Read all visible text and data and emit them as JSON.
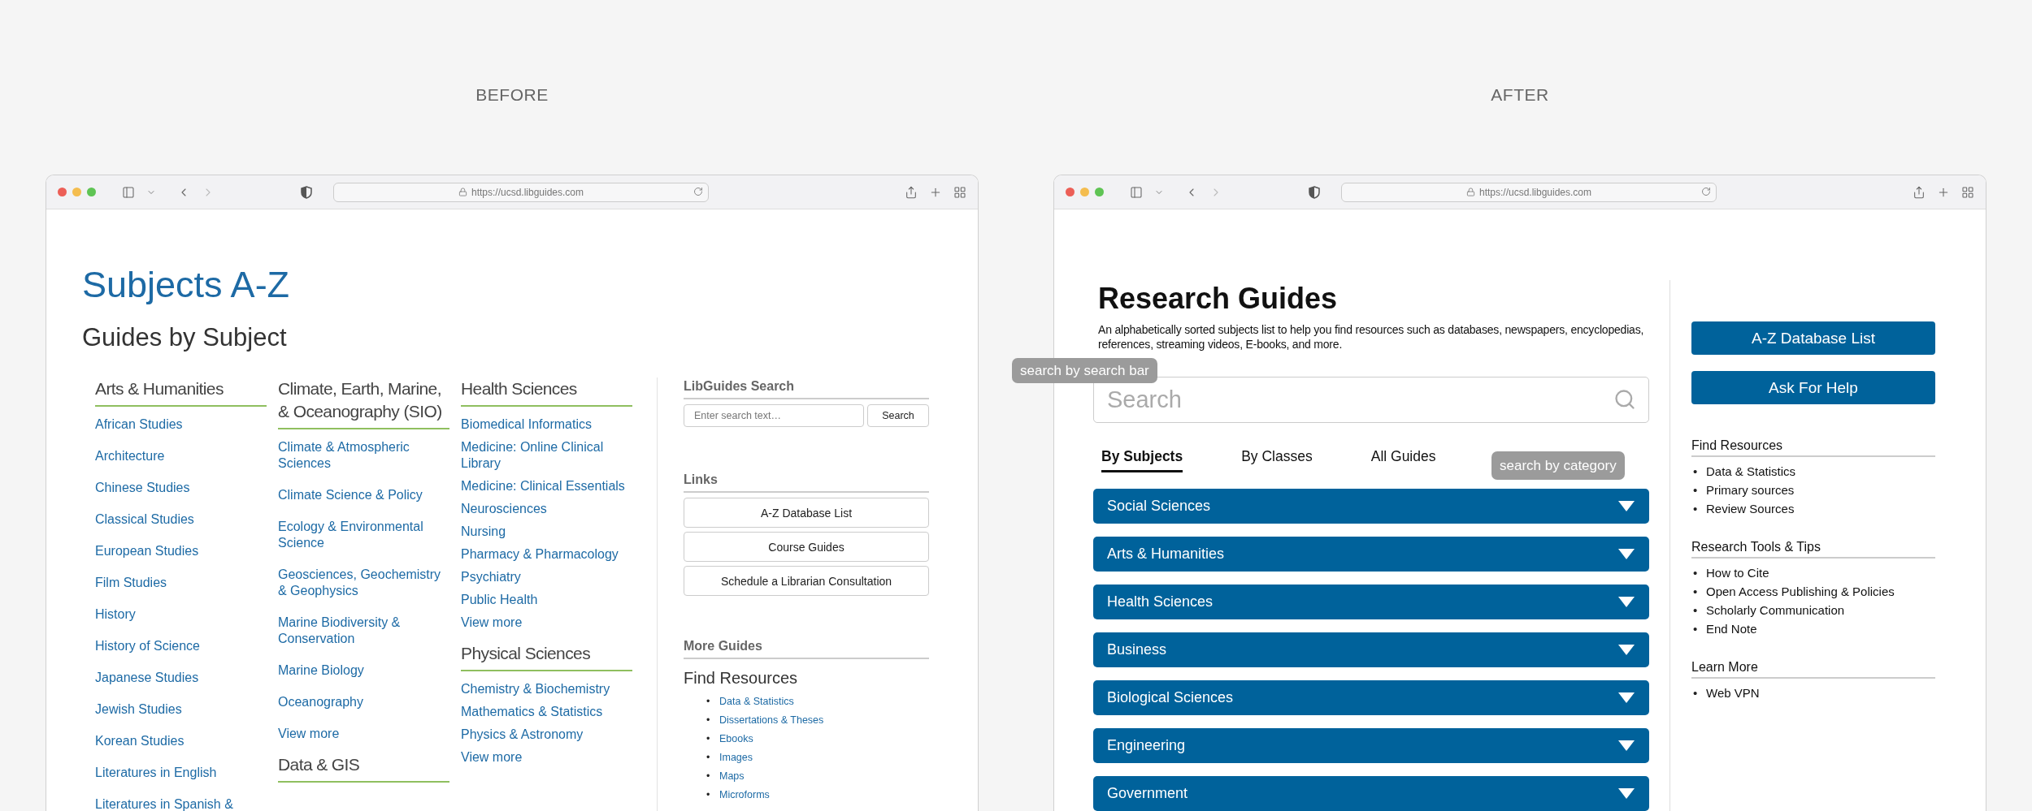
{
  "before": {
    "label": "BEFORE",
    "url": "https://ucsd.libguides.com",
    "title": "Subjects A-Z",
    "subtitle": "Guides by Subject",
    "columns": [
      {
        "sections": [
          {
            "heading": "Arts & Humanities",
            "links": [
              "African Studies",
              "Architecture",
              "Chinese Studies",
              "Classical Studies",
              "European Studies",
              "Film Studies",
              "History",
              "History of Science",
              "Japanese Studies",
              "Jewish Studies",
              "Korean Studies",
              "Literatures in English",
              "Literatures in Spanish &"
            ]
          }
        ]
      },
      {
        "sections": [
          {
            "heading": "Climate, Earth, Marine, & Oceanography (SIO)",
            "links": [
              "Climate & Atmospheric Sciences",
              "Climate Science & Policy",
              "Ecology & Environmental Science",
              "Geosciences, Geochemistry & Geophysics",
              "Marine Biodiversity & Conservation",
              "Marine Biology",
              "Oceanography",
              "View more"
            ]
          },
          {
            "heading": "Data & GIS"
          }
        ]
      },
      {
        "sections": [
          {
            "heading": "Health Sciences",
            "links": [
              "Biomedical Informatics",
              "Medicine: Online Clinical Library",
              "Medicine: Clinical Essentials",
              "Neurosciences",
              "Nursing",
              "Pharmacy & Pharmacology",
              "Psychiatry",
              "Public Health",
              "View more"
            ]
          },
          {
            "heading": "Physical Sciences",
            "links": [
              "Chemistry & Biochemistry",
              "Mathematics & Statistics",
              "Physics & Astronomy",
              "View more"
            ]
          }
        ]
      }
    ],
    "sidebar": {
      "search_heading": "LibGuides Search",
      "search_placeholder": "Enter search text…",
      "search_button": "Search",
      "links_heading": "Links",
      "links": [
        "A-Z Database List",
        "Course Guides",
        "Schedule a Librarian Consultation"
      ],
      "bullet": "•",
      "more_heading": "More Guides",
      "more_subheading": "Find Resources",
      "more_items": [
        "Data & Statistics",
        "Dissertations & Theses",
        "Ebooks",
        "Images",
        "Maps",
        "Microforms"
      ]
    }
  },
  "after": {
    "label": "AFTER",
    "url": "https://ucsd.libguides.com",
    "title": "Research Guides",
    "description": "An alphabetically sorted subjects list to help you find resources such as databases, newspapers, encyclopedias, references, streaming videos, E-books, and more.",
    "search": {
      "placeholder": "Search"
    },
    "tabs": [
      {
        "label": "By Subjects",
        "selected": true
      },
      {
        "label": "By Classes",
        "selected": false
      },
      {
        "label": "All Guides",
        "selected": false
      }
    ],
    "categories": [
      "Social Sciences",
      "Arts & Humanities",
      "Health Sciences",
      "Business",
      "Biological Sciences",
      "Engineering",
      "Government"
    ],
    "sidebar": {
      "bullet": "•",
      "buttons": [
        "A-Z Database List",
        "Ask For Help"
      ],
      "sections": [
        {
          "heading": "Find Resources",
          "items": [
            "Data & Statistics",
            "Primary sources",
            "Review Sources"
          ]
        },
        {
          "heading": "Research Tools & Tips",
          "items": [
            "How to Cite",
            "Open Access Publishing & Policies",
            "Scholarly Communication",
            "End Note"
          ]
        },
        {
          "heading": "Learn More",
          "items": [
            "Web VPN"
          ]
        }
      ]
    }
  },
  "annotations": [
    {
      "text": "search by search bar"
    },
    {
      "text": "search by category"
    }
  ]
}
